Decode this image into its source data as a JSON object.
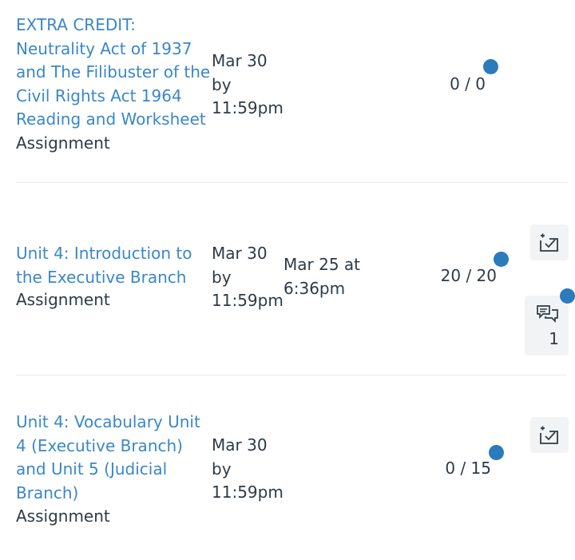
{
  "assignments": [
    {
      "title": "EXTRA CREDIT: Neutrality Act of 1937 and The Filibuster of the Civil Rights Act 1964 Reading and Worksheet",
      "title_lines": [
        "EXTRA CREDIT:",
        "Neutrality Act of 1937",
        "and The Filibuster of the",
        "Civil Rights Act 1964",
        "Reading and Worksheet"
      ],
      "type": "Assignment",
      "due_lines": [
        "Mar 30",
        "by",
        "11:59pm"
      ],
      "submitted_lines": [],
      "score": "0 / 0",
      "has_rubric_button": false,
      "has_comments_button": false
    },
    {
      "title": "Unit 4: Introduction to the Executive Branch",
      "title_lines": [
        "Unit 4: Introduction to",
        "the Executive Branch"
      ],
      "type": "Assignment",
      "due_lines": [
        "Mar 30",
        "by",
        "11:59pm"
      ],
      "submitted_lines": [
        "Mar 25 at",
        "6:36pm"
      ],
      "score": "20 / 20",
      "has_rubric_button": true,
      "has_comments_button": true,
      "comment_count": "1"
    },
    {
      "title": "Unit 4: Vocabulary Unit 4 (Executive Branch) and Unit 5 (Judicial Branch)",
      "title_lines": [
        "Unit 4: Vocabulary Unit",
        "4 (Executive Branch)",
        "and Unit 5 (Judicial",
        "Branch)"
      ],
      "type": "Assignment",
      "due_lines": [
        "Mar 30",
        "by",
        "11:59pm"
      ],
      "submitted_lines": [],
      "score": "0 / 15",
      "has_rubric_button": true,
      "has_comments_button": false
    }
  ],
  "colors": {
    "link": "#3a87c8",
    "text": "#2d3b45",
    "dot": "#2b7abc",
    "button_bg": "#f2f3f4",
    "divider": "#e6e9ec"
  },
  "icons": {
    "rubric": "rubric-icon",
    "comments": "comments-icon",
    "unread": "unread-dot-icon"
  }
}
